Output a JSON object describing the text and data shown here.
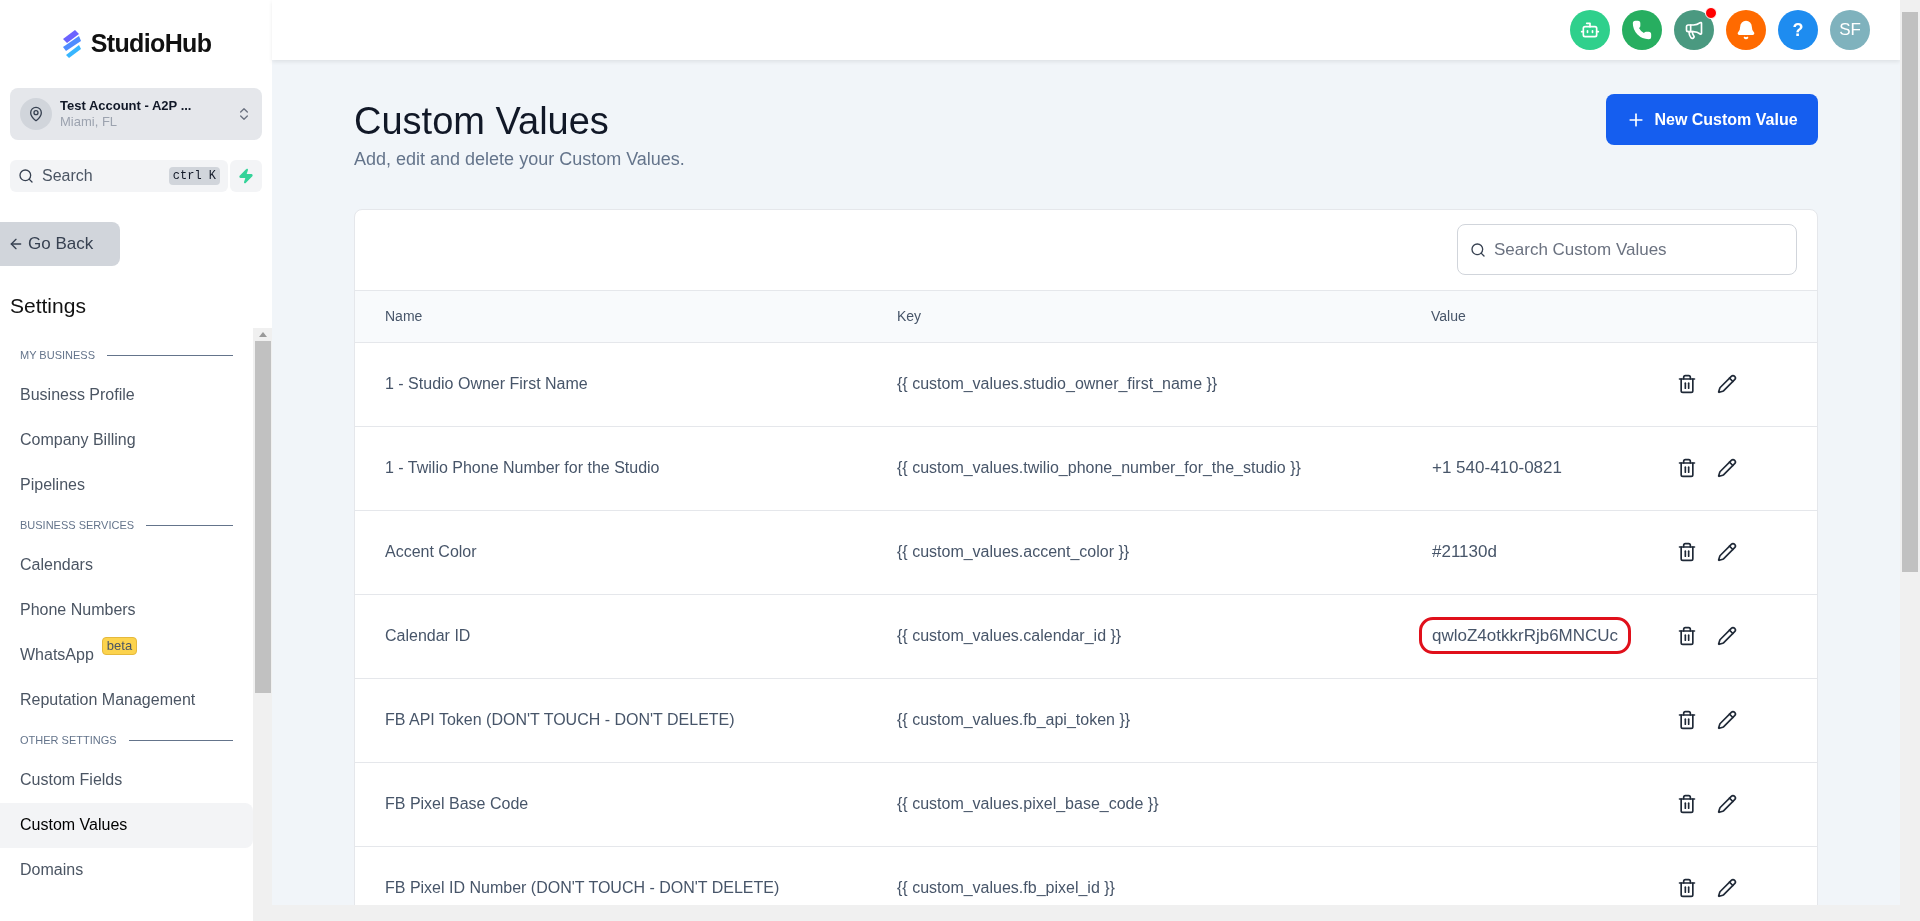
{
  "brand": {
    "name": "StudioHub"
  },
  "account": {
    "name": "Test Account - A2P ...",
    "location": "Miami, FL"
  },
  "sidebar_search": {
    "placeholder": "Search",
    "shortcut": "ctrl K"
  },
  "back_button": {
    "label": "Go Back"
  },
  "settings_title": "Settings",
  "nav": [
    {
      "kind": "section",
      "label": "MY BUSINESS"
    },
    {
      "kind": "item",
      "label": "Business Profile",
      "selected": false
    },
    {
      "kind": "item",
      "label": "Company Billing",
      "selected": false
    },
    {
      "kind": "item",
      "label": "Pipelines",
      "selected": false
    },
    {
      "kind": "section",
      "label": "BUSINESS SERVICES"
    },
    {
      "kind": "item",
      "label": "Calendars",
      "selected": false
    },
    {
      "kind": "item",
      "label": "Phone Numbers",
      "selected": false
    },
    {
      "kind": "item",
      "label": "WhatsApp",
      "badge": "beta",
      "selected": false
    },
    {
      "kind": "item",
      "label": "Reputation Management",
      "selected": false
    },
    {
      "kind": "section",
      "label": "OTHER SETTINGS"
    },
    {
      "kind": "item",
      "label": "Custom Fields",
      "selected": false
    },
    {
      "kind": "item",
      "label": "Custom Values",
      "selected": true
    },
    {
      "kind": "item",
      "label": "Domains",
      "selected": false
    }
  ],
  "header_buttons": [
    {
      "kind": "bot",
      "color": "#2fd08c"
    },
    {
      "kind": "phone",
      "color": "#27ae60"
    },
    {
      "kind": "megaphone",
      "color": "#4a9980",
      "dot": true
    },
    {
      "kind": "bell",
      "color": "#ff6a00"
    },
    {
      "kind": "help",
      "color": "#1e8cf0",
      "label": "?"
    },
    {
      "kind": "avatar",
      "color": "#7fb2bd",
      "label": "SF"
    }
  ],
  "page": {
    "title": "Custom Values",
    "subtitle": "Add, edit and delete your Custom Values.",
    "new_button": "New Custom Value"
  },
  "table": {
    "search_placeholder": "Search Custom Values",
    "columns": [
      "Name",
      "Key",
      "Value"
    ],
    "rows": [
      {
        "name": "1 - Studio Owner First Name",
        "key": "{{ custom_values.studio_owner_first_name }}"
      },
      {
        "name": "1 - Twilio Phone Number for the Studio",
        "key": "{{ custom_values.twilio_phone_number_for_the_studio }}",
        "value": "+1 540-410-0821"
      },
      {
        "name": "Accent Color",
        "key": "{{ custom_values.accent_color }}",
        "value": "#21130d"
      },
      {
        "name": "Calendar ID",
        "key": "{{ custom_values.calendar_id }}",
        "value": "qwloZ4otkkrRjb6MNCUc",
        "highlighted": true
      },
      {
        "name": "FB API Token (DON'T TOUCH - DON'T DELETE)",
        "key": "{{ custom_values.fb_api_token }}"
      },
      {
        "name": "FB Pixel Base Code",
        "key": "{{ custom_values.pixel_base_code }}"
      },
      {
        "name": "FB Pixel ID Number (DON'T TOUCH - DON'T DELETE)",
        "key": "{{ custom_values.fb_pixel_id }}"
      }
    ]
  }
}
